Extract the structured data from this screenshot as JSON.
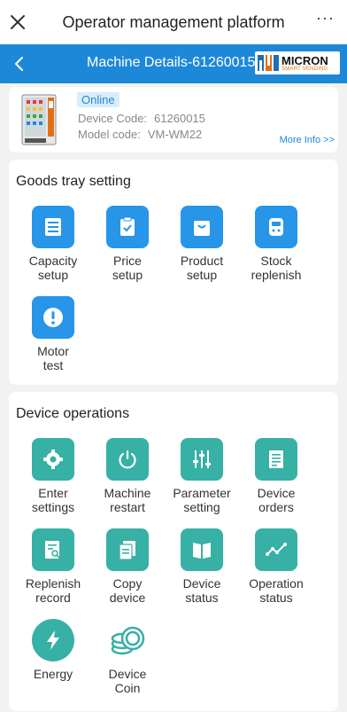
{
  "topbar": {
    "title": "Operator management platform",
    "more": "···"
  },
  "header": {
    "title": "Machine Details-61260015",
    "logo_brand": "MICRON",
    "logo_sub": "SMART VENDING",
    "logo_reg": "®"
  },
  "machine": {
    "status": "Online",
    "device_code_label": "Device Code:",
    "device_code": "61260015",
    "model_code_label": "Model code:",
    "model_code": "VM-WM22",
    "more_info": "More Info >>"
  },
  "tray": {
    "title": "Goods tray setting",
    "items": [
      {
        "label": "Capacity\nsetup",
        "icon": "capacity-icon"
      },
      {
        "label": "Price\nsetup",
        "icon": "clipboard-check-icon"
      },
      {
        "label": "Product\nsetup",
        "icon": "bag-icon"
      },
      {
        "label": "Stock\nreplenish",
        "icon": "machine-icon"
      },
      {
        "label": "Motor\ntest",
        "icon": "alert-icon"
      }
    ]
  },
  "ops": {
    "title": "Device operations",
    "items": [
      {
        "label": "Enter\nsettings",
        "icon": "gear-icon"
      },
      {
        "label": "Machine\nrestart",
        "icon": "power-icon"
      },
      {
        "label": "Parameter\nsetting",
        "icon": "sliders-icon"
      },
      {
        "label": "Device\norders",
        "icon": "document-icon"
      },
      {
        "label": "Replenish\nrecord",
        "icon": "record-search-icon"
      },
      {
        "label": "Copy\ndevice",
        "icon": "copy-icon"
      },
      {
        "label": "Device\nstatus",
        "icon": "book-icon"
      },
      {
        "label": "Operation\nstatus",
        "icon": "chart-line-icon"
      },
      {
        "label": "Energy",
        "icon": "bolt-icon"
      },
      {
        "label": "Device\nCoin",
        "icon": "coins-icon"
      }
    ]
  },
  "colors": {
    "header": "#1e88d8",
    "tray_icon": "#2795e8",
    "ops_icon": "#37b0a5"
  }
}
